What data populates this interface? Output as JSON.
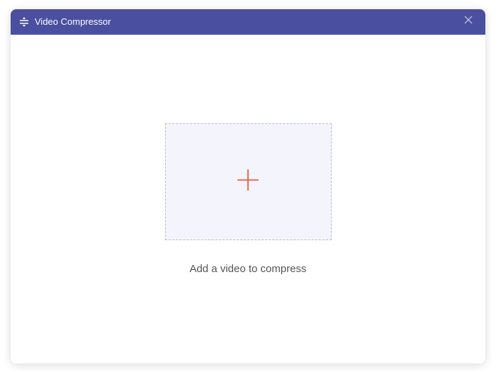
{
  "header": {
    "title": "Video Compressor",
    "app_icon": "compress-icon",
    "close_icon": "close-icon"
  },
  "main": {
    "dropzone_icon": "plus-icon",
    "instruction": "Add a video to compress"
  },
  "colors": {
    "titlebar_bg": "#4a4fa0",
    "dropzone_bg": "#f4f5fc",
    "dropzone_border": "#b8b8d8",
    "plus_color": "#f25c3c"
  }
}
